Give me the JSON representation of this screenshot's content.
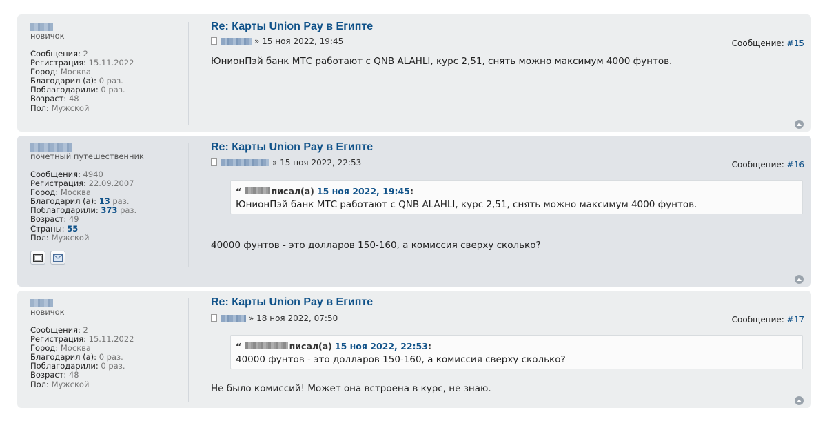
{
  "posts": [
    {
      "rank": "новичок",
      "stats": {
        "messages_label": "Сообщения:",
        "messages": "2",
        "registered_label": "Регистрация:",
        "registered": "15.11.2022",
        "city_label": "Город:",
        "city": "Москва",
        "thanked_label": "Благодарил (а):",
        "thanked": "0 раз.",
        "thanks_got_label": "Поблагодарили:",
        "thanks_got": "0 раз.",
        "age_label": "Возраст:",
        "age": "48",
        "sex_label": "Пол:",
        "sex": "Мужской"
      },
      "title": "Re: Карты Union Pay в Египте",
      "datetime": "» 15 ноя 2022, 19:45",
      "msg_label": "Сообщение:",
      "msg_num": "#15",
      "text": "ЮнионПэй банк МТС работают с QNB ALAHLI, курс 2,51, снять можно максимум 4000 фунтов."
    },
    {
      "rank": "почетный путешественник",
      "stats": {
        "messages_label": "Сообщения:",
        "messages": "4940",
        "registered_label": "Регистрация:",
        "registered": "22.09.2007",
        "city_label": "Город:",
        "city": "Москва",
        "thanked_label": "Благодарил (а):",
        "thanked_num": "13",
        "thanked_suffix": "раз.",
        "thanks_got_label": "Поблагодарили:",
        "thanks_got_num": "373",
        "thanks_got_suffix": "раз.",
        "age_label": "Возраст:",
        "age": "49",
        "countries_label": "Страны:",
        "countries": "55",
        "sex_label": "Пол:",
        "sex": "Мужской"
      },
      "title": "Re: Карты Union Pay в Египте",
      "datetime": "» 15 ноя 2022, 22:53",
      "msg_label": "Сообщение:",
      "msg_num": "#16",
      "quote": {
        "wrote": "писал(а)",
        "date": "15 ноя 2022, 19:45",
        "colon": ":",
        "text": "ЮнионПэй банк МТС работают с QNB ALAHLI, курс 2,51, снять можно максимум 4000 фунтов."
      },
      "text": "40000 фунтов - это долларов 150-160, а комиссия сверху сколько?"
    },
    {
      "rank": "новичок",
      "stats": {
        "messages_label": "Сообщения:",
        "messages": "2",
        "registered_label": "Регистрация:",
        "registered": "15.11.2022",
        "city_label": "Город:",
        "city": "Москва",
        "thanked_label": "Благодарил (а):",
        "thanked": "0 раз.",
        "thanks_got_label": "Поблагодарили:",
        "thanks_got": "0 раз.",
        "age_label": "Возраст:",
        "age": "48",
        "sex_label": "Пол:",
        "sex": "Мужской"
      },
      "title": "Re: Карты Union Pay в Египте",
      "datetime": "» 18 ноя 2022, 07:50",
      "msg_label": "Сообщение:",
      "msg_num": "#17",
      "quote": {
        "wrote": "писал(а)",
        "date": "15 ноя 2022, 22:53",
        "colon": ":",
        "text": "40000 фунтов - это долларов 150-160, а комиссия сверху сколько?"
      },
      "text": "Не было комиссий! Может она встроена в курс, не знаю."
    }
  ],
  "icons": {
    "website": "website-icon",
    "email": "email-icon",
    "doc": "post-document-icon",
    "top": "back-to-top-icon"
  },
  "colors": {
    "link": "#105289",
    "post_bg_light": "#eceeef",
    "post_bg_blue": "#e1e4e8"
  }
}
